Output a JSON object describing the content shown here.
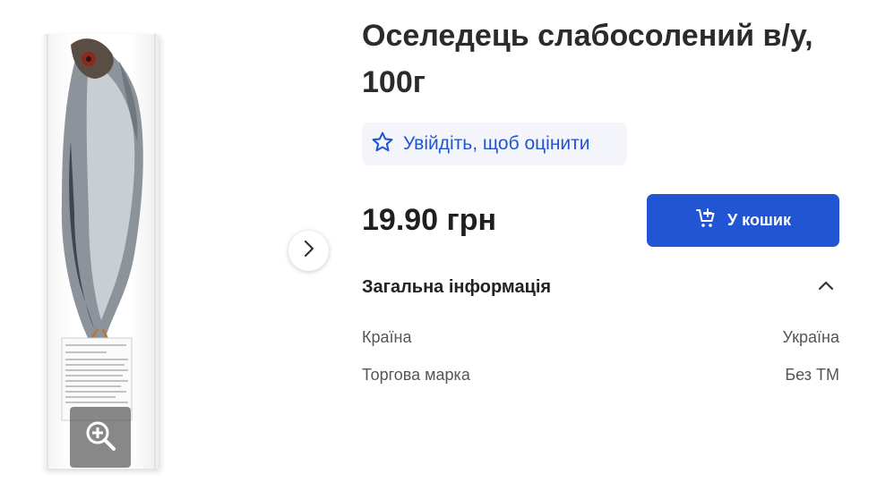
{
  "product": {
    "title": "Оселедець слабосолений в/у, 100г",
    "rating_prompt": "Увійдіть, щоб оцінити",
    "price": "19.90 грн",
    "add_to_cart_label": "У кошик"
  },
  "info": {
    "section_title": "Загальна інформація",
    "rows": [
      {
        "label": "Країна",
        "value": "Україна"
      },
      {
        "label": "Торгова марка",
        "value": "Без ТМ"
      }
    ]
  },
  "colors": {
    "accent": "#2155d4",
    "rating_bg": "#f3f5fb",
    "text_dark": "#2b2b2b",
    "text_muted": "#555555"
  },
  "icons": {
    "zoom": "zoom-in-icon",
    "next": "chevron-right-icon",
    "rating": "star-outline-icon",
    "cart": "cart-add-icon",
    "collapse": "chevron-up-icon"
  }
}
